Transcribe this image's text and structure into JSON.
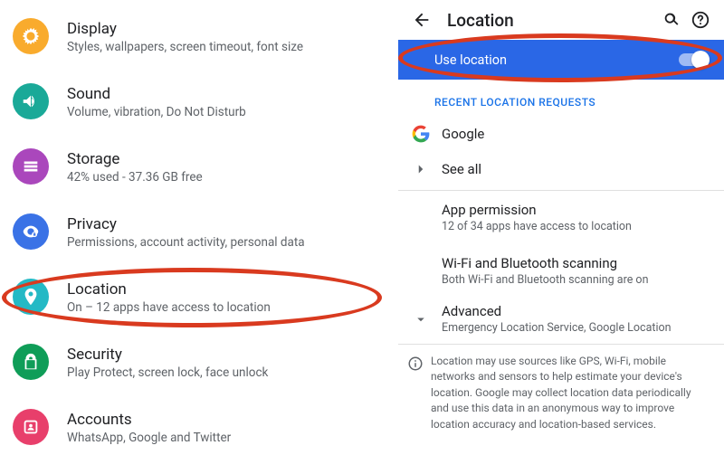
{
  "left": {
    "items": [
      {
        "title": "Display",
        "sub": "Styles, wallpapers, screen timeout, font size",
        "icon": "display-icon",
        "bg": "#f9ab2d"
      },
      {
        "title": "Sound",
        "sub": "Volume, vibration, Do Not Disturb",
        "icon": "sound-icon",
        "bg": "#1aa998"
      },
      {
        "title": "Storage",
        "sub": "42% used - 37.36 GB free",
        "icon": "storage-icon",
        "bg": "#aa47bc"
      },
      {
        "title": "Privacy",
        "sub": "Permissions, account activity, personal data",
        "icon": "privacy-icon",
        "bg": "#3a72e6"
      },
      {
        "title": "Location",
        "sub": "On – 12 apps have access to location",
        "icon": "location-icon",
        "bg": "#24b9c5"
      },
      {
        "title": "Security",
        "sub": "Play Protect, screen lock, face unlock",
        "icon": "security-icon",
        "bg": "#0f9d58"
      },
      {
        "title": "Accounts",
        "sub": "WhatsApp, Google and Twitter",
        "icon": "accounts-icon",
        "bg": "#e83f6b"
      }
    ]
  },
  "right": {
    "title": "Location",
    "banner": {
      "label": "Use location",
      "state": "on"
    },
    "recent_header": "RECENT LOCATION REQUESTS",
    "recent": [
      {
        "label": "Google"
      },
      {
        "label": "See all"
      }
    ],
    "blocks": [
      {
        "title": "App permission",
        "sub": "12 of 34 apps have access to location"
      },
      {
        "title": "Wi-Fi and Bluetooth scanning",
        "sub": "Both Wi-Fi and Bluetooth scanning are on"
      }
    ],
    "advanced": {
      "title": "Advanced",
      "sub": "Emergency Location Service, Google Location"
    },
    "info": "Location may use sources like GPS, Wi-Fi, mobile networks and sensors to help estimate your device's location. Google may collect location data periodically and use this data in an anonymous way to improve location accuracy and location-based services."
  }
}
